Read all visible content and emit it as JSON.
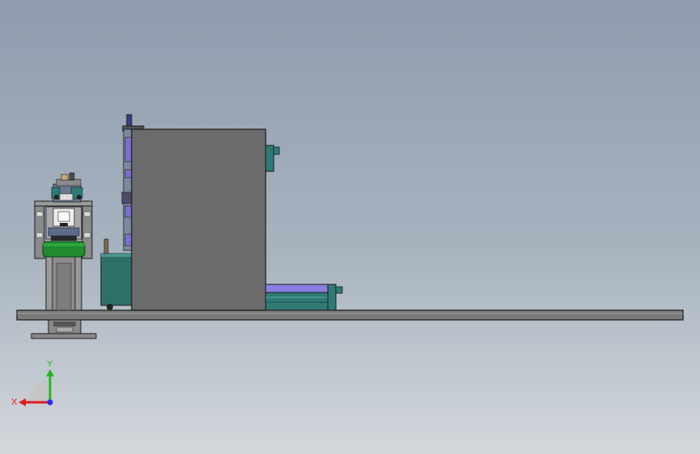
{
  "viewport": {
    "colors": {
      "background_top": "#8e9cae",
      "background_mid": "#a7b3bf",
      "background_bottom": "#d2d7db",
      "cabinet": "#6b6b6b",
      "outline": "#1c1c1c",
      "base_plate": "#787878",
      "press_frame": "#8a8a8a",
      "accent_teal": "#2f7a74",
      "accent_green": "#1f8a2e",
      "accent_purple": "#7a70d0",
      "accent_navy": "#3a3f8a",
      "light_part": "#d8d8d8"
    }
  },
  "triad": {
    "x_label": "X",
    "y_label": "Y",
    "x_color": "#e01e1e",
    "y_color": "#22b822",
    "z_color": "#2a2af0"
  }
}
